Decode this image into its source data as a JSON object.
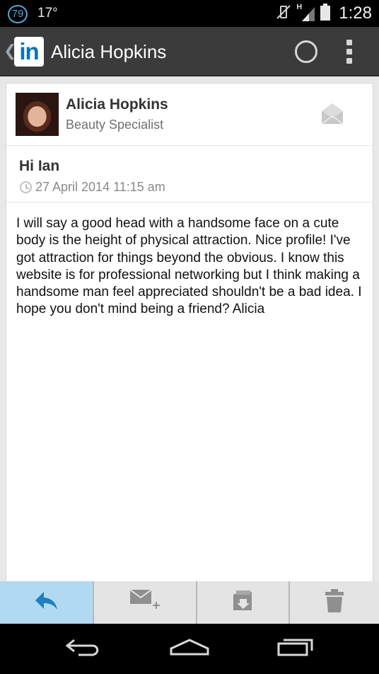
{
  "status_bar": {
    "notification_count": "79",
    "temperature": "17°",
    "network_type": "H",
    "time": "1:28"
  },
  "action_bar": {
    "title": "Alicia Hopkins",
    "logo_text": "in"
  },
  "message": {
    "sender_name": "Alicia Hopkins",
    "sender_title": "Beauty Specialist",
    "subject": "Hi Ian",
    "timestamp": "27 April 2014 11:15 am",
    "body": "I will say a good head with a handsome face on a cute body is the height of physical attraction. Nice profile! I've got attraction for things beyond the obvious. I know this website is for professional networking but I think making a handsome man feel appreciated shouldn't be a bad idea. I hope you don't mind being a friend? Alicia"
  },
  "bottom_actions": [
    {
      "icon": "reply-icon",
      "active": true
    },
    {
      "icon": "compose-message-icon",
      "active": false
    },
    {
      "icon": "archive-icon",
      "active": false
    },
    {
      "icon": "trash-icon",
      "active": false
    }
  ],
  "colors": {
    "linkedin_blue": "#0a74b5",
    "active_action": "#b2d9f2",
    "reply_icon": "#1e7fc2"
  }
}
